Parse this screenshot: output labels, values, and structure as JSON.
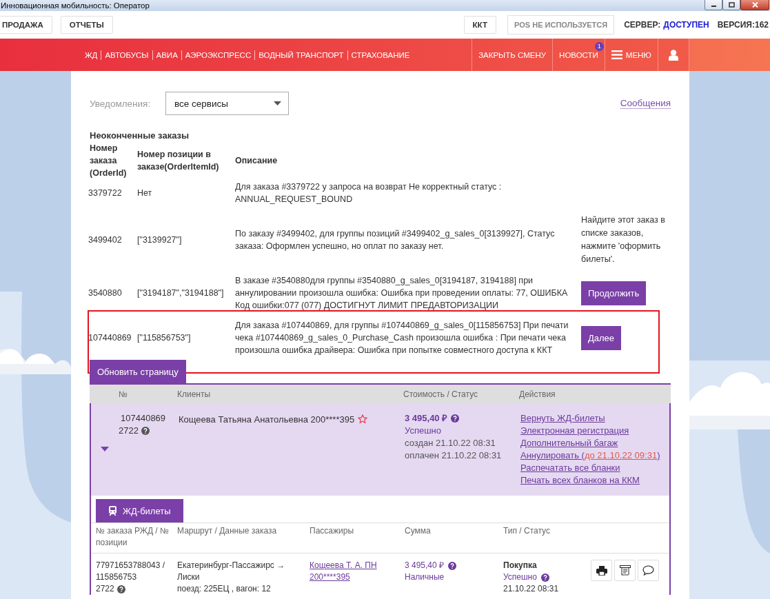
{
  "window": {
    "title": "Инновационная мобильность: Оператор"
  },
  "top_bar": {
    "left_buttons": [
      "ПРОДАЖА",
      "ОТЧЕТЫ"
    ],
    "kkt_button": "ККТ",
    "pos_status": "POS НЕ ИСПОЛЬЗУЕТСЯ",
    "server_label": "СЕРВЕР:",
    "server_status": "ДОСТУПЕН",
    "version": "ВЕРСИЯ:162"
  },
  "nav": {
    "links": [
      "ЖД",
      "АВТОБУСЫ",
      "АВИА",
      "АЭРОЭКСПРЕСС",
      "ВОДНЫЙ ТРАНСПОРТ",
      "СТРАХОВАНИЕ"
    ],
    "right_items": [
      {
        "kind": "link",
        "label": "ЗАКРЫТЬ СМЕНУ"
      },
      {
        "kind": "news",
        "label": "НОВОСТИ",
        "badge": "1"
      },
      {
        "kind": "menu",
        "label": "МЕНЮ"
      },
      {
        "kind": "user"
      }
    ]
  },
  "notifications": {
    "label": "Уведомления:",
    "select_value": "все сервисы",
    "messages_link": "Сообщения"
  },
  "unfinished": {
    "title": "Неоконченные заказы",
    "columns": [
      "Номер заказа (OrderId)",
      "Номер позиции в заказе(OrderItemId)",
      "Описание"
    ],
    "rows": [
      {
        "order_id": "3379722",
        "item_id": "Нет",
        "description": "Для заказа #3379722 у запроса на возврат Не корректный статус : ANNUAL_REQUEST_BOUND",
        "highlighted": false
      },
      {
        "order_id": "3499402",
        "item_id": "[\"3139927\"]",
        "description": "По заказу #3499402, для группы позиций #3499402_g_sales_0[3139927], Статус заказа: Оформлен успешно, но оплат по заказу нет.",
        "hint": "Найдите этот заказ в списке заказов, нажмите 'оформить билеты'.",
        "highlighted": false
      },
      {
        "order_id": "3540880",
        "item_id": "[\"3194187\",\"3194188\"]",
        "description": "В заказе #3540880для группы #3540880_g_sales_0[3194187, 3194188] при аннулировании произошла ошибка: Ошибка при проведении оплаты: 77, ОШИБКА Код ошибки:077 (077) ДОСТИГНУТ ЛИМИТ ПРЕДАВТОРИЗАЦИИ",
        "action": "Продолжить",
        "highlighted": false
      },
      {
        "order_id": "107440869",
        "item_id": "[\"115856753\"]",
        "description": "Для заказа #107440869, для группы #107440869_g_sales_0[115856753] При печати чека #107440869_g_sales_0_Purchase_Cash произошла ошибка : При печати чека произошла ошибка драйвера: Ошибка при попытке совместного доступа к ККТ",
        "action": "Далее",
        "highlighted": true
      }
    ]
  },
  "refresh_button": "Обновить страницу",
  "orders": {
    "columns": [
      "№",
      "Клиенты",
      "Стоимость / Статус",
      "Действия"
    ],
    "rows": [
      {
        "number": "107440869",
        "code": "2722",
        "client": "Кощеева Татьяна Анатольевна 200****395",
        "amount": "3 495,40 ₽",
        "status": "Успешно",
        "created": "создан 21.10.22 08:31",
        "paid": "оплачен 21.10.22 08:31",
        "expanded": true,
        "actions": [
          {
            "kind": "link",
            "label": "Вернуть ЖД-билеты"
          },
          {
            "kind": "link",
            "label": "Электронная регистрация"
          },
          {
            "kind": "link",
            "label": "Дополнительный багаж"
          },
          {
            "kind": "deadline",
            "label": "Аннулировать (",
            "deadline": "до 21.10.22 09:31",
            "tail": ")"
          },
          {
            "kind": "link",
            "label": "Распечатать все бланки"
          },
          {
            "kind": "link",
            "label": "Печать всех бланков на ККМ"
          }
        ]
      }
    ]
  },
  "tickets": {
    "tab_label": "ЖД-билеты",
    "columns": [
      "№ заказа РЖД / № позиции",
      "Маршрут / Данные заказа",
      "Пассажиры",
      "Сумма",
      "Тип / Статус"
    ],
    "rows": [
      {
        "order_no": "77971653788043 / 115856753",
        "code": "2722",
        "route": "Екатеринбург-Пассажирс → Лиски",
        "train": "поезд: 225ЕЦ , вагон: 12",
        "passenger": "Кощеева Т. А. ПН 200****395",
        "amount": "3 495,40 ₽",
        "payment": "Наличные",
        "type": "Покупка",
        "status": "Успешно",
        "date": "21.10.22 08:31"
      }
    ]
  }
}
